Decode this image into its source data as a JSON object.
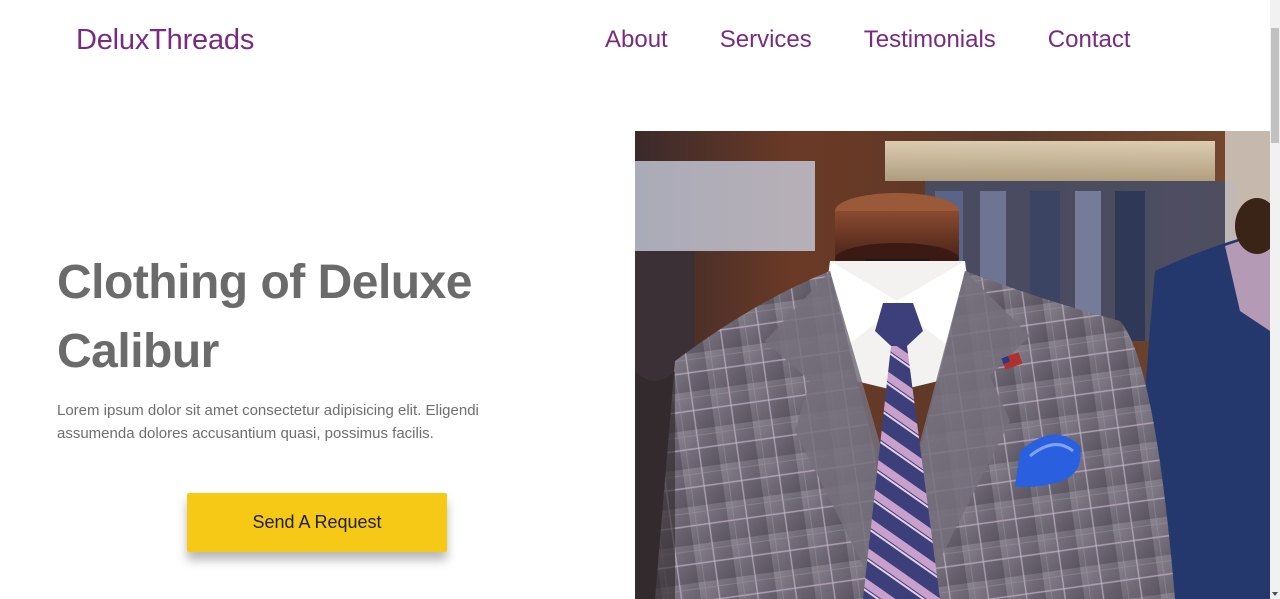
{
  "header": {
    "brand": "DeluxThreads",
    "nav": [
      "About",
      "Services",
      "Testimonials",
      "Contact"
    ]
  },
  "hero": {
    "title": "Clothing of Deluxe Calibur",
    "description": "Lorem ipsum dolor sit amet consectetur adipisicing elit. Eligendi assumenda dolores accusantium quasi, possimus facilis.",
    "cta_label": "Send A Request",
    "image_icon": "suit-mannequin-photo"
  },
  "colors": {
    "brand": "#7b2a84",
    "heading": "#6b6b6b",
    "body": "#6e6e6e",
    "cta": "#f5c915"
  }
}
